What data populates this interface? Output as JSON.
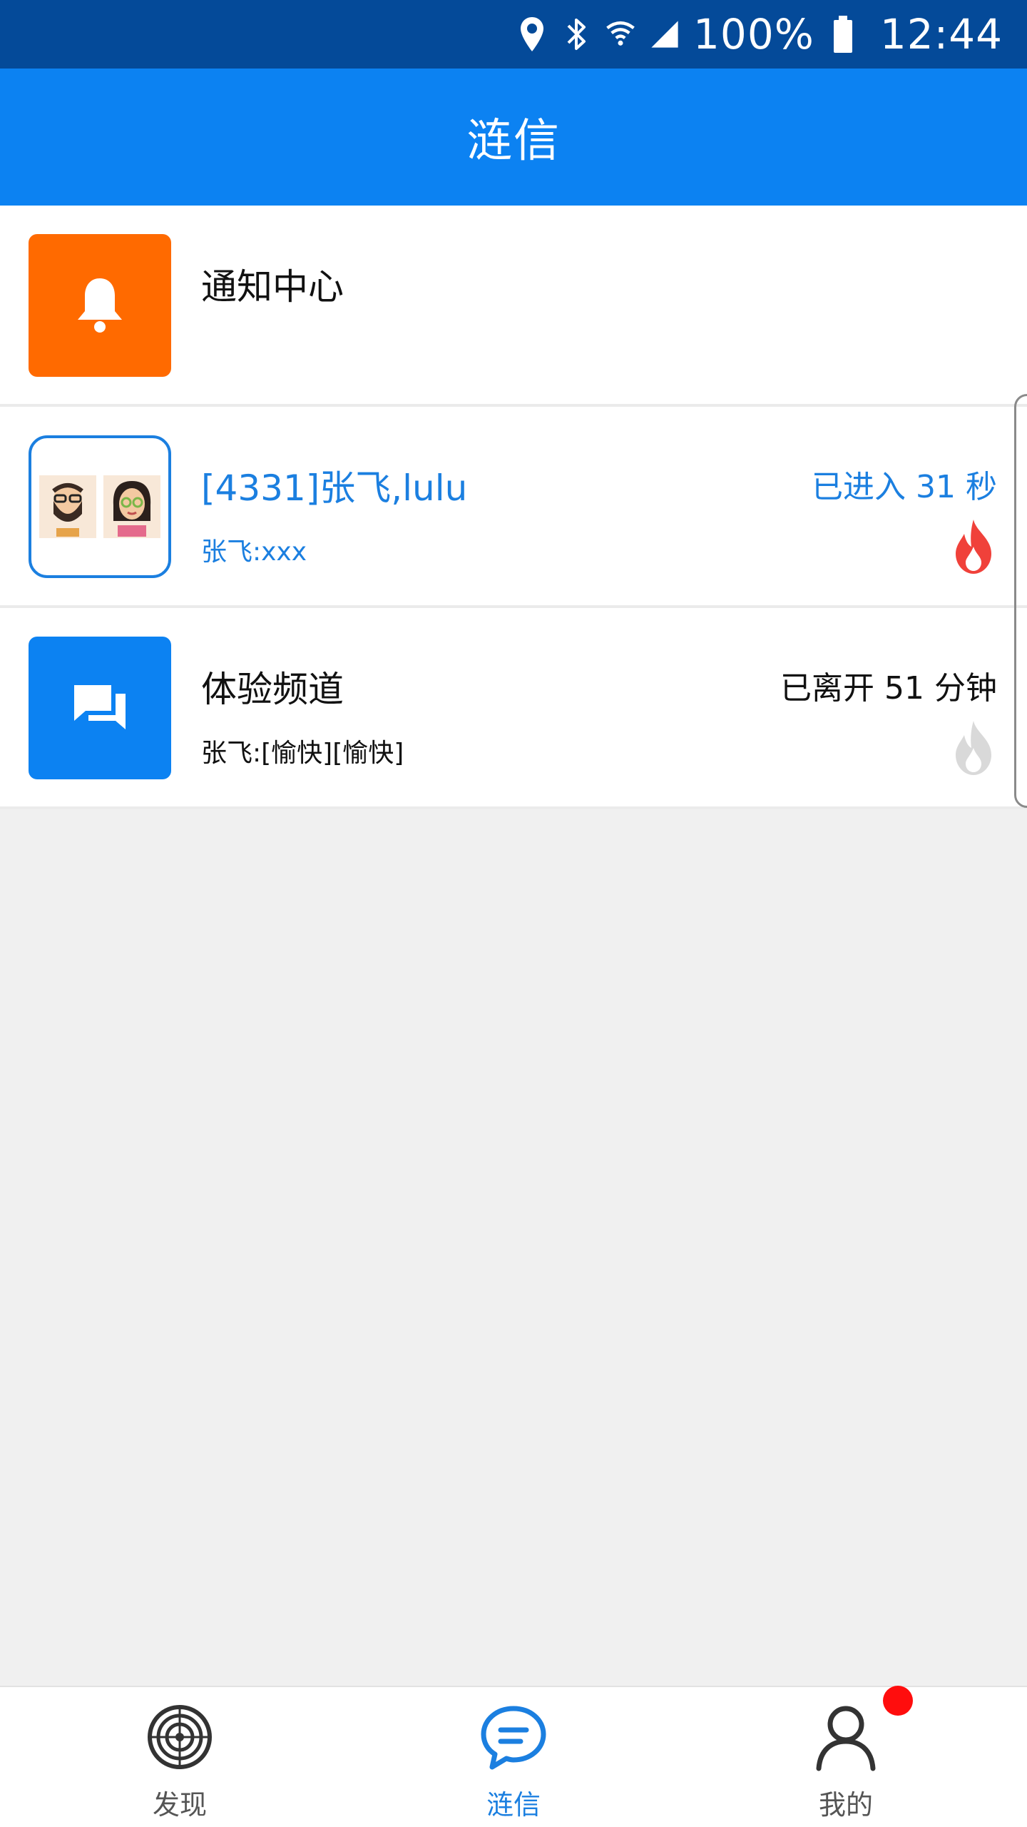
{
  "status_bar": {
    "battery": "100%",
    "time": "12:44",
    "icons": [
      "location-icon",
      "bluetooth-icon",
      "wifi-icon",
      "signal-icon",
      "battery-icon"
    ]
  },
  "header": {
    "title": "涟信"
  },
  "list": [
    {
      "title": "通知中心",
      "subtitle": "",
      "right_text": "",
      "icon": "bell-icon",
      "icon_color": "#ff6a00"
    },
    {
      "title": "[4331]张飞,lulu",
      "subtitle": "张飞:xxx",
      "right_text": "已进入 31 秒",
      "icon": "group-avatar-icon",
      "accent": "#1b7fe0",
      "flame": "active"
    },
    {
      "title": "体验频道",
      "subtitle": "张飞:[愉快][愉快]",
      "right_text": "已离开 51 分钟",
      "icon": "chat-bubbles-icon",
      "icon_color": "#0c82f2",
      "flame": "inactive"
    }
  ],
  "bottom_nav": {
    "items": [
      {
        "label": "发现",
        "icon": "target-icon",
        "active": false
      },
      {
        "label": "涟信",
        "icon": "message-icon",
        "active": true
      },
      {
        "label": "我的",
        "icon": "user-icon",
        "active": false,
        "badge": true
      }
    ]
  },
  "colors": {
    "status_bar": "#044a99",
    "app_bar": "#0c82f2",
    "accent": "#1b7fe0",
    "flame_active": "#f0413a",
    "flame_inactive": "#d9d9d9",
    "badge": "#ff0d0d"
  }
}
